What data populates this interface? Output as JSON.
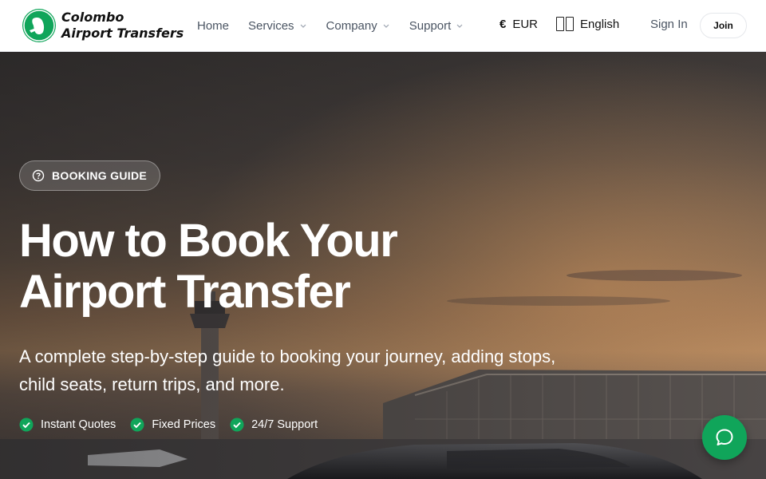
{
  "brand": {
    "line1": "Colombo",
    "line2": "Airport Transfers",
    "icon": "plane-logo-icon",
    "color": "#10a55a"
  },
  "nav": {
    "items": [
      {
        "label": "Home",
        "has_dropdown": false
      },
      {
        "label": "Services",
        "has_dropdown": true
      },
      {
        "label": "Company",
        "has_dropdown": true
      },
      {
        "label": "Support",
        "has_dropdown": true
      }
    ],
    "currency_symbol": "€",
    "currency": "EUR",
    "language": "English",
    "signin": "Sign In",
    "join": "Join"
  },
  "hero": {
    "badge": "BOOKING GUIDE",
    "badge_icon": "help-circle-icon",
    "title_line1": "How to Book Your",
    "title_line2": "Airport Transfer",
    "subtitle": "A complete step-by-step guide to booking your journey, adding stops, child seats, return trips, and more.",
    "features": [
      "Instant Quotes",
      "Fixed Prices",
      "24/7 Support"
    ],
    "feature_icon": "check-circle-icon",
    "accent": "#10a55a"
  },
  "chat": {
    "icon": "chat-bubble-icon"
  }
}
